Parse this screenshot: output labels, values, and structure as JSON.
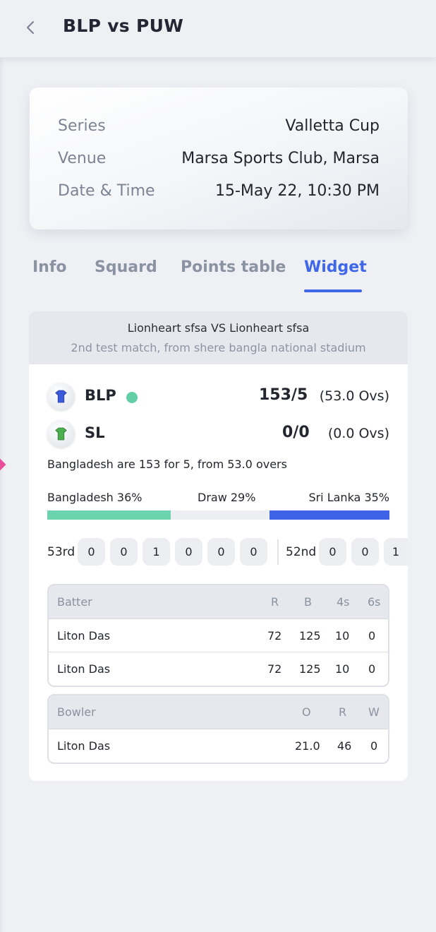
{
  "header": {
    "title": "BLP vs PUW"
  },
  "info": [
    {
      "label": "Series",
      "value": "Valletta Cup"
    },
    {
      "label": "Venue",
      "value": "Marsa Sports Club, Marsa"
    },
    {
      "label": "Date & Time",
      "value": "15-May 22, 10:30 PM"
    }
  ],
  "tabs": [
    {
      "label": "Info",
      "active": false
    },
    {
      "label": "Squard",
      "active": false
    },
    {
      "label": "Points table",
      "active": false
    },
    {
      "label": "Widget",
      "active": true
    }
  ],
  "widget": {
    "title": "Lionheart sfsa VS Lionheart sfsa",
    "subtitle": "2nd test match, from shere bangla national stadium",
    "teams": [
      {
        "name": "BLP",
        "score": "153/5",
        "overs": "(53.0 Ovs)",
        "batting": true,
        "jersey_color": "#3b5bdb"
      },
      {
        "name": "SL",
        "score": "0/0",
        "overs": "(0.0 Ovs)",
        "batting": false,
        "jersey_color": "#4caf50"
      }
    ],
    "summary": "Bangladesh are 153 for 5, from 53.0 overs",
    "win_probability": {
      "team_a": {
        "label": "Bangladesh 36%",
        "percent": 36,
        "color": "#6bd3ad"
      },
      "draw": {
        "label": "Draw 29%",
        "percent": 29,
        "color": "#eceef2"
      },
      "team_b": {
        "label": "Sri Lanka 35%",
        "percent": 35,
        "color": "#3f63e6"
      }
    },
    "overs": [
      {
        "label": "53rd",
        "balls": [
          "0",
          "0",
          "1",
          "0",
          "0",
          "0"
        ]
      },
      {
        "label": "52nd",
        "balls": [
          "0",
          "0",
          "1"
        ]
      }
    ],
    "batting": {
      "headers": [
        "Batter",
        "R",
        "B",
        "4s",
        "6s"
      ],
      "rows": [
        [
          "Liton Das",
          "72",
          "125",
          "10",
          "0"
        ],
        [
          "Liton Das",
          "72",
          "125",
          "10",
          "0"
        ]
      ]
    },
    "bowling": {
      "headers": [
        "Bowler",
        "O",
        "R",
        "W"
      ],
      "rows": [
        [
          "Liton Das",
          "21.0",
          "46",
          "0"
        ]
      ]
    }
  }
}
